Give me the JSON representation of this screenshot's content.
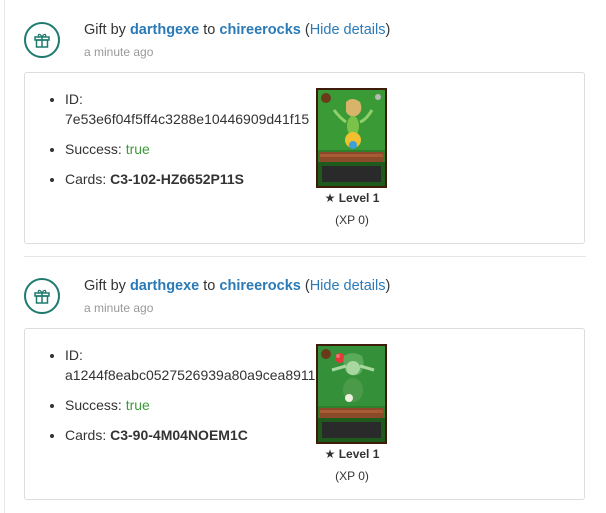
{
  "entries": [
    {
      "prefix": "Gift by",
      "from_user": "darthgexe",
      "to_word": "to",
      "to_user": "chireerocks",
      "open_paren": "(",
      "toggle_label": "Hide details",
      "close_paren": ")",
      "time": "a minute ago",
      "id_label": "ID:",
      "id_value": "7e53e6f04f5ff4c3288e10446909d41f15",
      "success_label": "Success:",
      "success_value": "true",
      "cards_label": "Cards:",
      "cards_value": "C3-102-HZ6652P11S",
      "level_label": "Level 1",
      "xp_label": "(XP 0)",
      "card_icon": "green-fairy-card-art"
    },
    {
      "prefix": "Gift by",
      "from_user": "darthgexe",
      "to_word": "to",
      "to_user": "chireerocks",
      "open_paren": "(",
      "toggle_label": "Hide details",
      "close_paren": ")",
      "time": "a minute ago",
      "id_label": "ID:",
      "id_value": "a1244f8eabc0527526939a80a9cea8911",
      "success_label": "Success:",
      "success_value": "true",
      "cards_label": "Cards:",
      "cards_value": "C3-90-4M04NOEM1C",
      "level_label": "Level 1",
      "xp_label": "(XP 0)",
      "card_icon": "green-elf-card-art"
    }
  ],
  "colors": {
    "accent": "#1f7a6e",
    "link": "#2a7ab8",
    "success": "#3c9a3c",
    "muted": "#999999"
  },
  "icons": {
    "gift": "gift-icon",
    "star": "star-icon"
  }
}
